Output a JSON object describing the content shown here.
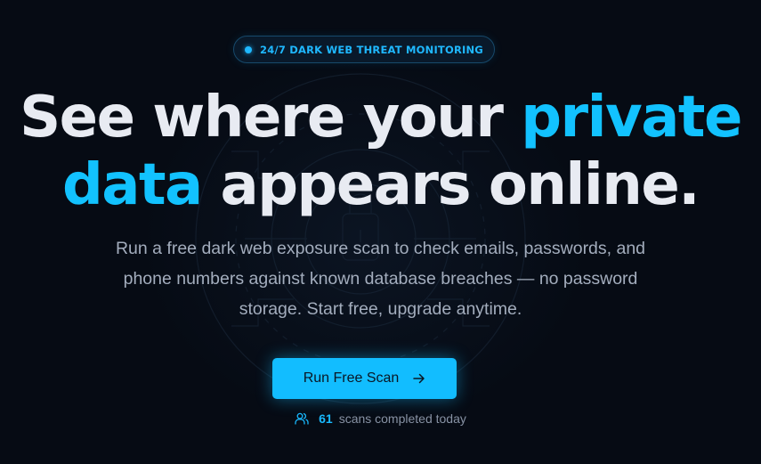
{
  "badge": {
    "text": "24/7 DARK WEB THREAT MONITORING"
  },
  "headline": {
    "line1_main": "See where your ",
    "line1_accent": "private",
    "line2_accent": "data",
    "line2_main": " appears online."
  },
  "subtitle": {
    "line1": "Run a free dark web exposure scan to check emails, passwords, and",
    "line2": "phone numbers against known database breaches — no password",
    "line3": "storage. Start free, upgrade anytime."
  },
  "cta": {
    "label": "Run Free Scan",
    "icon": "arrow-right-icon"
  },
  "stats": {
    "icon": "users-icon",
    "count": "61",
    "text": "scans completed today"
  },
  "colors": {
    "background": "#060b14",
    "accent": "#12c2ff",
    "headline": "#e8ebf2",
    "subtitle": "#a3adbd",
    "button": "#12bdff"
  }
}
